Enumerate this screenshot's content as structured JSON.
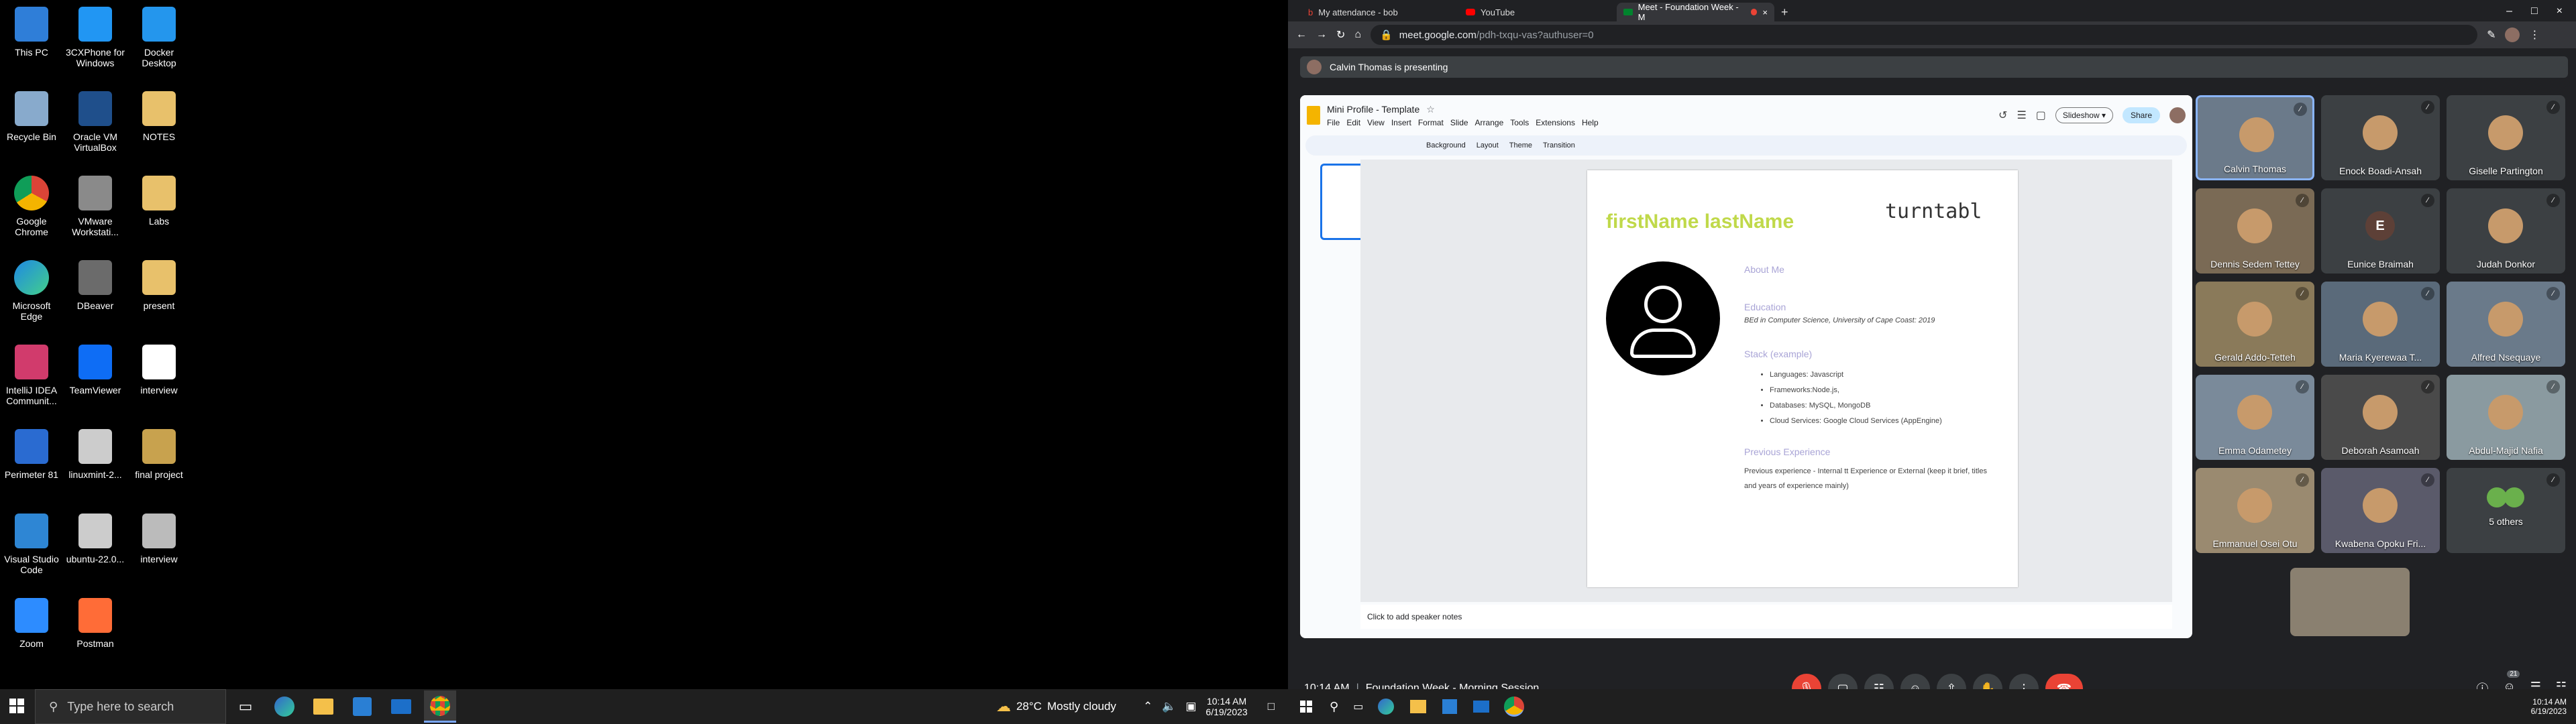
{
  "desktop": {
    "icons": [
      {
        "label": "This PC"
      },
      {
        "label": "3CXPhone for Windows"
      },
      {
        "label": "Docker Desktop"
      },
      {
        "label": "Recycle Bin"
      },
      {
        "label": "Oracle VM VirtualBox"
      },
      {
        "label": "NOTES"
      },
      {
        "label": "Google Chrome"
      },
      {
        "label": "VMware Workstati..."
      },
      {
        "label": "Labs"
      },
      {
        "label": "Microsoft Edge"
      },
      {
        "label": "DBeaver"
      },
      {
        "label": "present"
      },
      {
        "label": "IntelliJ IDEA Communit..."
      },
      {
        "label": "TeamViewer"
      },
      {
        "label": "interview"
      },
      {
        "label": "Perimeter 81"
      },
      {
        "label": "linuxmint-2..."
      },
      {
        "label": "final project"
      },
      {
        "label": "Visual Studio Code"
      },
      {
        "label": "ubuntu-22.0..."
      },
      {
        "label": "interview"
      },
      {
        "label": "Zoom"
      },
      {
        "label": "Postman"
      }
    ]
  },
  "taskbar1": {
    "search_placeholder": "Type here to search",
    "weather_temp": "28°C",
    "weather_text": "Mostly cloudy",
    "time": "10:14 AM",
    "date": "6/19/2023"
  },
  "browser": {
    "tabs": [
      {
        "title": "My attendance - bob"
      },
      {
        "title": "YouTube"
      },
      {
        "title": "Meet - Foundation Week - M"
      }
    ],
    "url": "meet.google.com",
    "url_rest": "/pdh-txqu-vas?authuser=0"
  },
  "meet": {
    "presenting": "Calvin Thomas is presenting",
    "time": "10:14 AM",
    "meeting": "Foundation Week - Morning Session",
    "people_count": "21",
    "participants": [
      {
        "name": "Calvin Thomas",
        "initial": ""
      },
      {
        "name": "Enock Boadi-Ansah",
        "initial": ""
      },
      {
        "name": "Giselle Partington",
        "initial": ""
      },
      {
        "name": "Dennis Sedem Tettey",
        "initial": ""
      },
      {
        "name": "Eunice Braimah",
        "initial": "E"
      },
      {
        "name": "Judah Donkor",
        "initial": ""
      },
      {
        "name": "Gerald Addo-Tetteh",
        "initial": ""
      },
      {
        "name": "Maria Kyerewaa T...",
        "initial": ""
      },
      {
        "name": "Alfred Nsequaye",
        "initial": ""
      },
      {
        "name": "Emma Odametey",
        "initial": ""
      },
      {
        "name": "Deborah Asamoah",
        "initial": ""
      },
      {
        "name": "Abdul-Majid Nafia",
        "initial": ""
      },
      {
        "name": "Emmanuel Osei Otu",
        "initial": ""
      },
      {
        "name": "Kwabena Opoku Fri...",
        "initial": ""
      },
      {
        "name": "5 others",
        "initial": ""
      }
    ]
  },
  "slides": {
    "doc_title": "Mini Profile - Template",
    "menu": [
      "File",
      "Edit",
      "View",
      "Insert",
      "Format",
      "Slide",
      "Arrange",
      "Tools",
      "Extensions",
      "Help"
    ],
    "toolbar": [
      "Background",
      "Layout",
      "Theme",
      "Transition"
    ],
    "slideshow": "Slideshow",
    "share": "Share",
    "notes_placeholder": "Click to add speaker notes",
    "slide": {
      "name": "firstName lastName",
      "brand": "turntabl",
      "about": "About Me",
      "education": "Education",
      "education_text": "BEd in Computer Science, University of Cape Coast: 2019",
      "stack": "Stack (example)",
      "stack_items": [
        "Languages: Javascript",
        "Frameworks:Node.js,",
        "Databases: MySQL, MongoDB",
        "Cloud Services: Google Cloud Services (AppEngine)"
      ],
      "experience": "Previous Experience",
      "experience_text": "Previous experience - Internal tt Experience or External (keep it brief, titles and years of experience mainly)"
    }
  },
  "taskbar2": {
    "time": "10:14 AM",
    "date": "6/19/2023"
  },
  "colors": {
    "accent": "#c0d94a",
    "danger": "#ea4335",
    "blue": "#1a73e8",
    "lavender": "#a9a4d6"
  }
}
